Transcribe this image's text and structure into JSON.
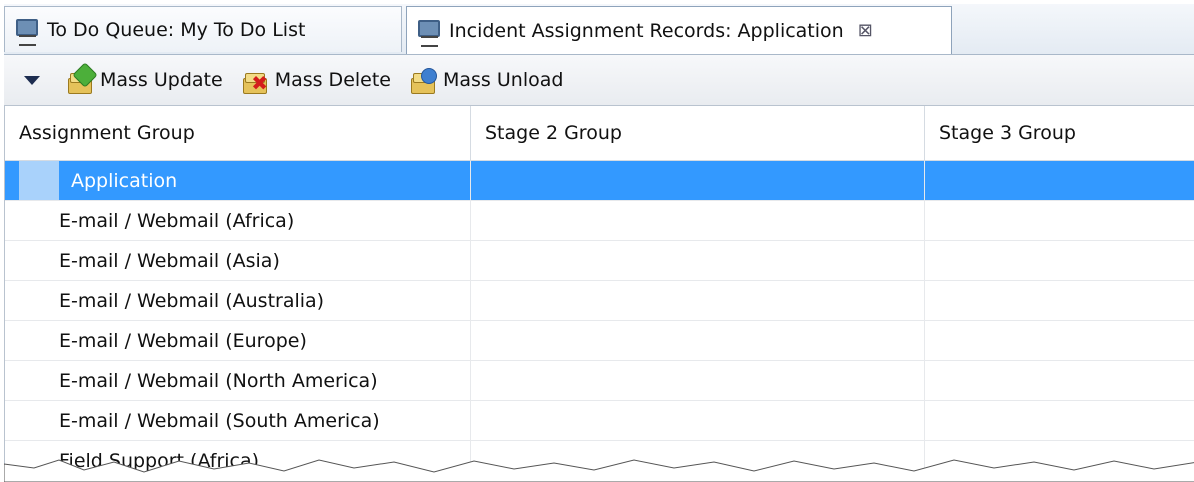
{
  "tabs": [
    {
      "label": "To Do Queue: My To Do List",
      "icon": "monitor-icon",
      "active": false
    },
    {
      "label": "Incident Assignment Records:  Application",
      "icon": "monitor-icon",
      "active": true,
      "close": "⊠"
    }
  ],
  "toolbar": {
    "mass_update": "Mass Update",
    "mass_delete": "Mass Delete",
    "mass_unload": "Mass Unload"
  },
  "table": {
    "columns": [
      "Assignment Group",
      "Stage 2 Group",
      "Stage 3 Group"
    ],
    "rows": [
      [
        "Application",
        "",
        ""
      ],
      [
        "E-mail / Webmail (Africa)",
        "",
        ""
      ],
      [
        "E-mail / Webmail (Asia)",
        "",
        ""
      ],
      [
        "E-mail / Webmail (Australia)",
        "",
        ""
      ],
      [
        "E-mail / Webmail (Europe)",
        "",
        ""
      ],
      [
        "E-mail / Webmail (North America)",
        "",
        ""
      ],
      [
        "E-mail / Webmail (South America)",
        "",
        ""
      ],
      [
        "Field Support (Africa)",
        "",
        ""
      ]
    ],
    "selected_row": 0
  },
  "colors": {
    "selection": "#3399ff",
    "selection_marker": "#a9d2fb"
  }
}
